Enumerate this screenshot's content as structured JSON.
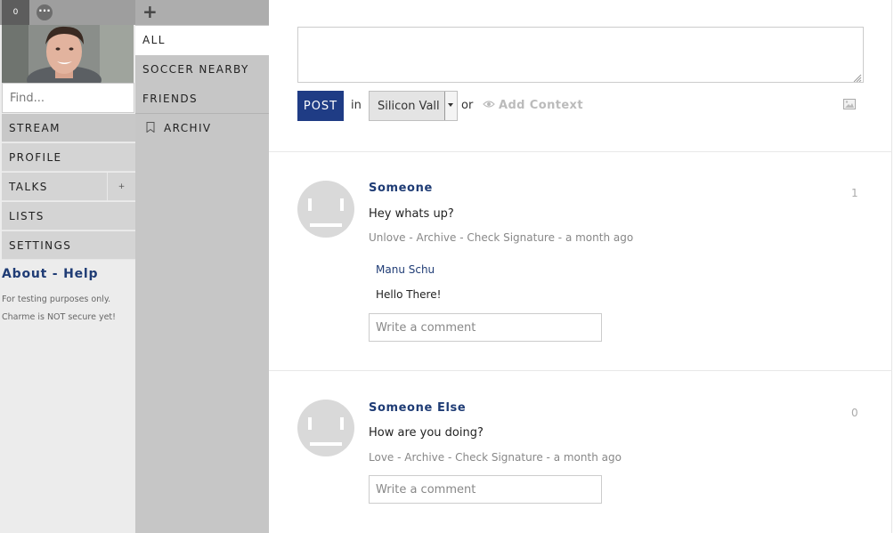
{
  "sidebar": {
    "notification_count": "0",
    "find_placeholder": "Find...",
    "nav": [
      {
        "label": "STREAM"
      },
      {
        "label": "PROFILE"
      },
      {
        "label": "TALKS",
        "action": "+"
      },
      {
        "label": "LISTS"
      },
      {
        "label": "SETTINGS"
      }
    ],
    "about_help": "About - Help",
    "disclaimer_line1": "For testing purposes only.",
    "disclaimer_line2": "Charme is NOT secure yet!"
  },
  "streams": {
    "items": [
      {
        "label": "ALL",
        "selected": true
      },
      {
        "label": "SOCCER NEARBY"
      },
      {
        "label": "FRIENDS"
      },
      {
        "label": "ARCHIV"
      }
    ]
  },
  "composer": {
    "post_label": "POST",
    "in_label": "in",
    "context_value": "Silicon Vall",
    "or_label": "or",
    "add_context_label": "Add Context"
  },
  "posts": [
    {
      "author": "Someone",
      "text": "Hey whats up?",
      "meta": "Unlove - Archive - Check Signature - a month ago",
      "count": "1",
      "comments": [
        {
          "author": "Manu Schu",
          "text": "Hello There!"
        }
      ],
      "comment_placeholder": "Write a comment"
    },
    {
      "author": "Someone Else",
      "text": "How are you doing?",
      "meta": "Love - Archive - Check Signature - a month ago",
      "count": "0",
      "comments": [],
      "comment_placeholder": "Write a comment"
    }
  ],
  "colors": {
    "accent": "#1f3c85",
    "link": "#1f3c75",
    "sidebar_bg": "#ececec",
    "stream_bg": "#c6c6c6"
  }
}
